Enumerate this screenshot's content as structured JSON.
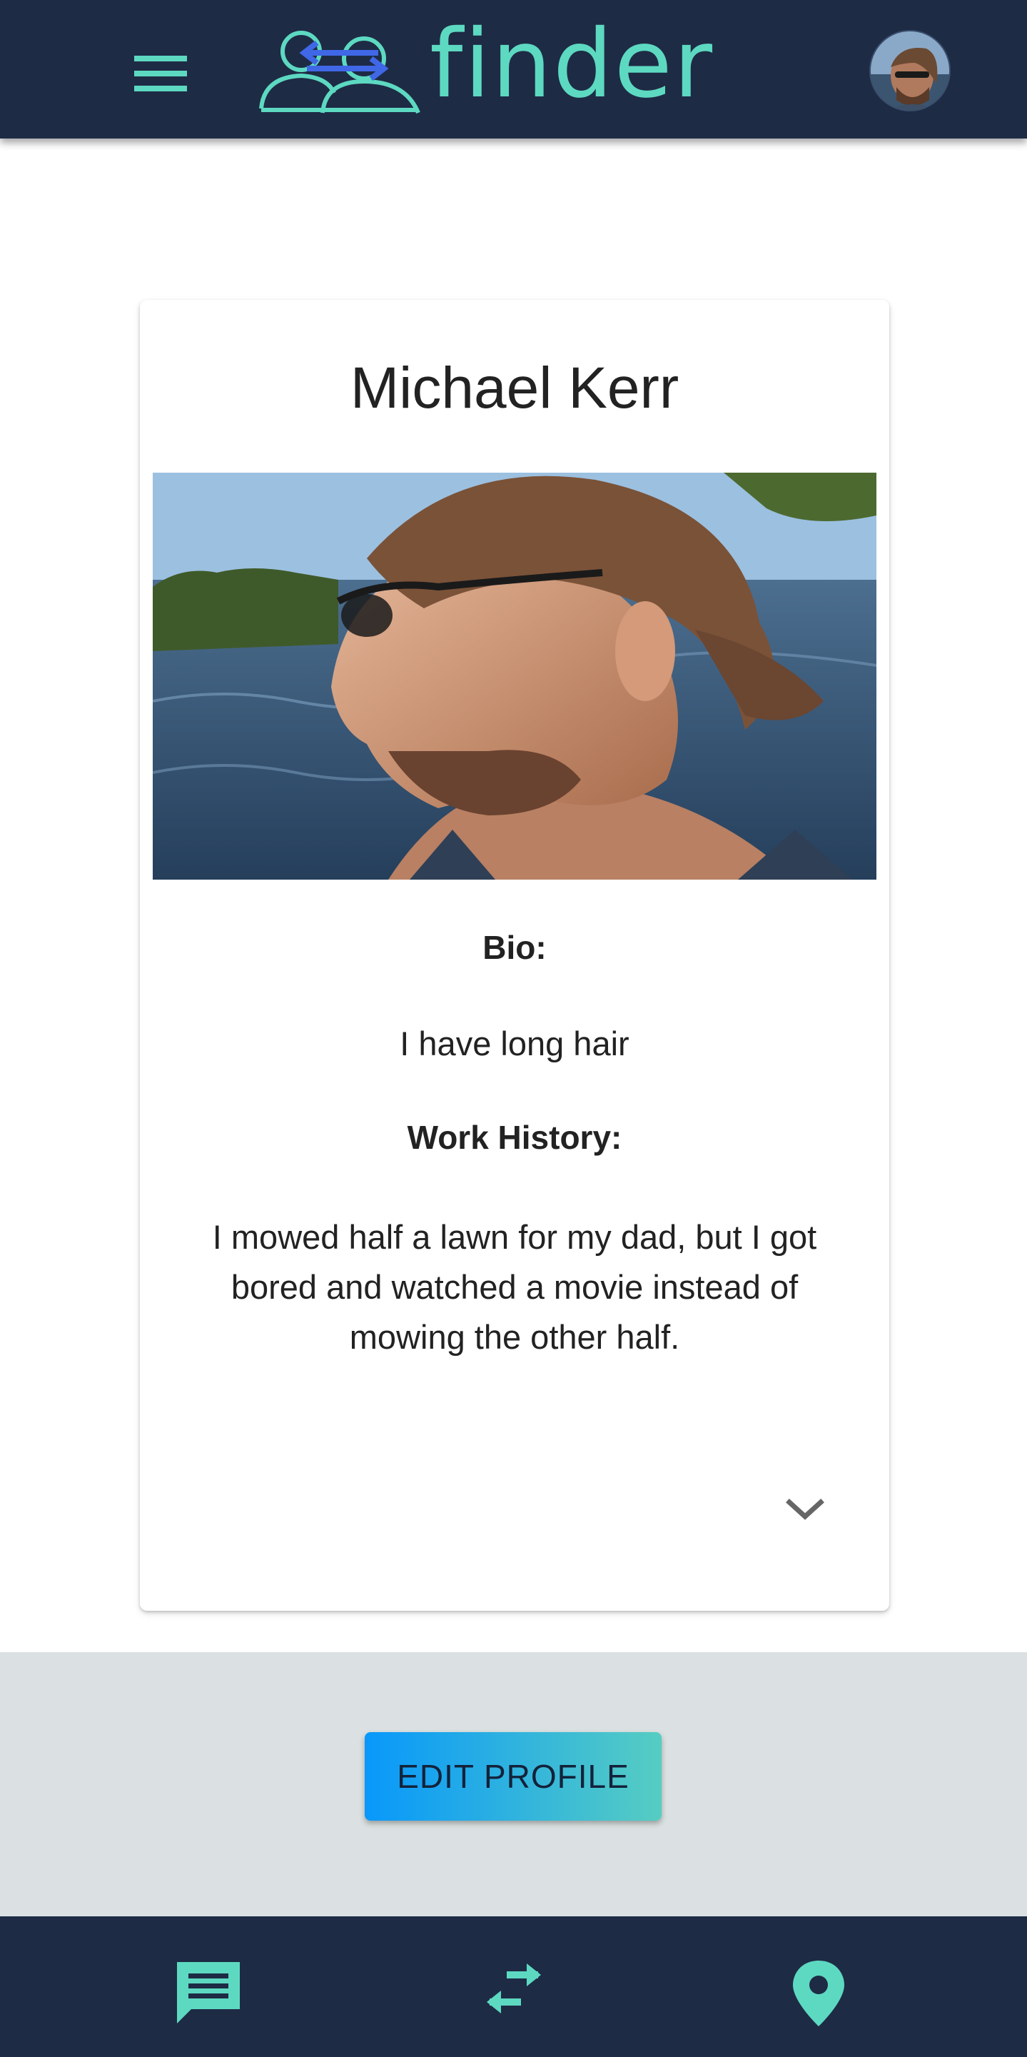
{
  "header": {
    "logo_text": "finder",
    "menu_icon": "hamburger-menu-icon",
    "avatar": "user-avatar"
  },
  "profile": {
    "name": "Michael Kerr",
    "bio_label": "Bio:",
    "bio": "I have long hair",
    "work_label": "Work History:",
    "work_history": "I mowed half a lawn for my dad, but I got bored and watched a movie instead of mowing the other half.",
    "expand_icon": "chevron-down-icon"
  },
  "actions": {
    "edit_profile_label": "EDIT PROFILE"
  },
  "bottom_nav": {
    "items": [
      {
        "icon": "chat-icon"
      },
      {
        "icon": "swap-arrows-icon"
      },
      {
        "icon": "location-pin-icon"
      }
    ]
  },
  "colors": {
    "navy": "#1e2b45",
    "teal": "#5dd9c1",
    "blue": "#0898fb",
    "strip": "#dbe1e2"
  }
}
